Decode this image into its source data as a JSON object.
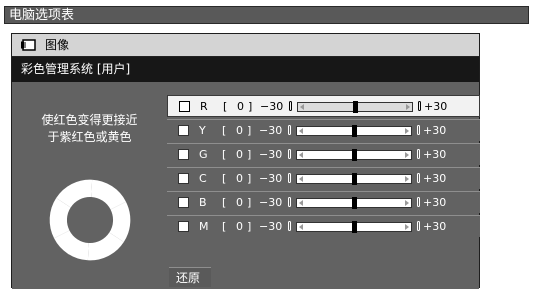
{
  "top_title": "电脑选项表",
  "panel": {
    "section_icon": "picture-icon",
    "section_title": "图像",
    "subtitle": "彩色管理系统 [用户]",
    "description_lines": [
      "使红色变得更接近",
      "于紫红色或黄色"
    ],
    "wheel_icon": "color-wheel-icon",
    "reset_label": "还原"
  },
  "sliders": [
    {
      "label": "R",
      "value": "0",
      "min": "−30",
      "max": "+30",
      "level": 0,
      "selected": true
    },
    {
      "label": "Y",
      "value": "0",
      "min": "−30",
      "max": "+30",
      "level": 0,
      "selected": false
    },
    {
      "label": "G",
      "value": "0",
      "min": "−30",
      "max": "+30",
      "level": 0,
      "selected": false
    },
    {
      "label": "C",
      "value": "0",
      "min": "−30",
      "max": "+30",
      "level": 0,
      "selected": false
    },
    {
      "label": "B",
      "value": "0",
      "min": "−30",
      "max": "+30",
      "level": 0,
      "selected": false
    },
    {
      "label": "M",
      "value": "0",
      "min": "−30",
      "max": "+30",
      "level": 0,
      "selected": false
    }
  ]
}
